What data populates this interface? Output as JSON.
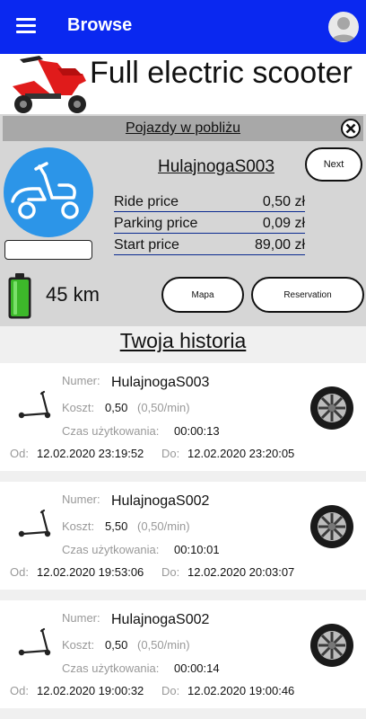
{
  "appbar": {
    "title": "Browse"
  },
  "banner": {
    "title": "Full electric scooter"
  },
  "nearby": {
    "header": "Pojazdy w pobliżu",
    "vehicle_name": "HulajnogaS003",
    "next_label": "Next",
    "prices": [
      {
        "label": "Ride price",
        "value": "0,50 zł"
      },
      {
        "label": "Parking price",
        "value": "0,09 zł"
      },
      {
        "label": "Start price",
        "value": "89,00 zł"
      }
    ],
    "range": "45 km",
    "map_label": "Mapa",
    "reservation_label": "Reservation"
  },
  "history": {
    "title": "Twoja historia",
    "labels": {
      "number": "Numer:",
      "cost": "Koszt:",
      "time": "Czas użytkowania:",
      "from": "Od:",
      "to": "Do:"
    },
    "items": [
      {
        "number": "HulajnogaS003",
        "cost": "0,50",
        "rate": "(0,50/min)",
        "duration": "00:00:13",
        "from": "12.02.2020 23:19:52",
        "to": "12.02.2020 23:20:05"
      },
      {
        "number": "HulajnogaS002",
        "cost": "5,50",
        "rate": "(0,50/min)",
        "duration": "00:10:01",
        "from": "12.02.2020 19:53:06",
        "to": "12.02.2020 20:03:07"
      },
      {
        "number": "HulajnogaS002",
        "cost": "0,50",
        "rate": "(0,50/min)",
        "duration": "00:00:14",
        "from": "12.02.2020 19:00:32",
        "to": "12.02.2020 19:00:46"
      }
    ]
  },
  "colors": {
    "appbar": "#0a28f0",
    "vehicle_icon_bg": "#2c95e8",
    "battery_fill": "#3db82a"
  },
  "icons": {
    "menu": "hamburger-menu-icon",
    "avatar": "user-avatar-icon",
    "close": "close-circle-icon",
    "vehicle": "moped-icon",
    "battery": "battery-full-icon",
    "history_vehicle": "kick-scooter-icon",
    "wheel": "wheel-icon"
  }
}
